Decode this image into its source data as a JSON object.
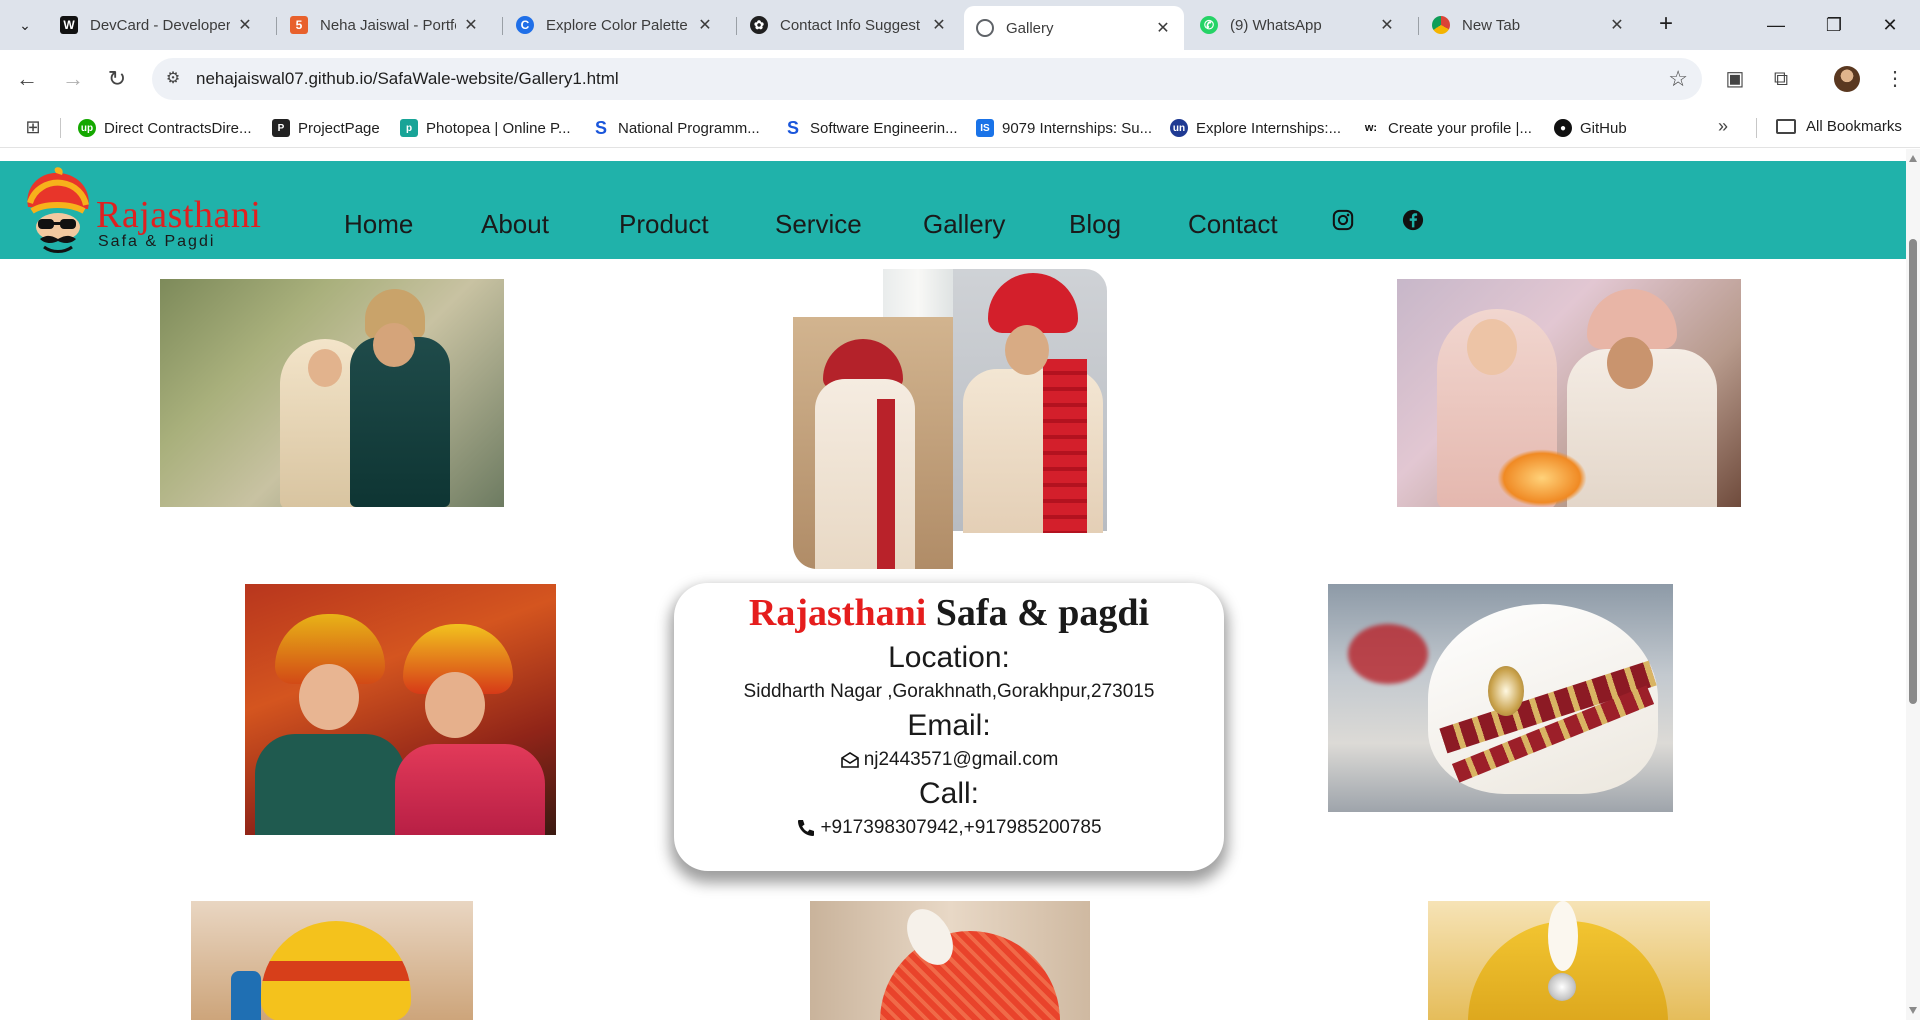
{
  "browser": {
    "tabs": [
      {
        "title": "DevCard - Developer",
        "icon": "w-icon",
        "color": "#111111"
      },
      {
        "title": "Neha Jaiswal - Portfo",
        "icon": "html5-icon",
        "color": "#e8612c"
      },
      {
        "title": "Explore Color Palette",
        "icon": "coolors-icon",
        "color": "#1f6fe8"
      },
      {
        "title": "Contact Info Suggest",
        "icon": "chatgpt-icon",
        "color": "#202020"
      },
      {
        "title": "Gallery",
        "icon": "globe-icon",
        "color": "#5f6368",
        "active": true
      },
      {
        "title": "(9) WhatsApp",
        "icon": "whatsapp-icon",
        "color": "#25d366"
      },
      {
        "title": "New Tab",
        "icon": "chrome-icon",
        "color": "#5f6368"
      }
    ],
    "url": "nehajaiswal07.github.io/SafaWale-website/Gallery1.html",
    "bookmarks": [
      {
        "label": "Direct ContractsDire...",
        "color": "#14a800",
        "letter": "up"
      },
      {
        "label": "ProjectPage",
        "color": "#222222",
        "letter": "P"
      },
      {
        "label": "Photopea | Online P...",
        "color": "#18a497",
        "letter": "p"
      },
      {
        "label": "National Programm...",
        "color": "#1a56db",
        "letter": "S"
      },
      {
        "label": "Software Engineerin...",
        "color": "#1a56db",
        "letter": "S"
      },
      {
        "label": "9079 Internships: Su...",
        "color": "#1a73e8",
        "letter": "IS"
      },
      {
        "label": "Explore Internships:...",
        "color": "#1f3a93",
        "letter": "un"
      },
      {
        "label": "Create your profile |...",
        "color": "#111111",
        "letter": "w:"
      },
      {
        "label": "GitHub",
        "color": "#111111",
        "letter": "gh"
      }
    ],
    "all_bookmarks_label": "All Bookmarks"
  },
  "site": {
    "logo_text": "Rajasthani",
    "logo_sub": "Safa & Pagdi",
    "nav": [
      "Home",
      "About",
      "Product",
      "Service",
      "Gallery",
      "Blog",
      "Contact"
    ],
    "social": [
      "instagram-icon",
      "facebook-icon"
    ],
    "brand_colors": {
      "nav_bg": "#20b2aa",
      "accent_red": "#e51d1d"
    }
  },
  "contact": {
    "title_red": "Rajasthani",
    "title_rest": " Safa & pagdi",
    "location_heading": "Location:",
    "location": "Siddharth Nagar ,Gorakhnath,Gorakhpur,273015",
    "email_heading": "Email:",
    "email": "nj2443571@gmail.com",
    "call_heading": "Call:",
    "phone": "+917398307942,+917985200785"
  },
  "gallery": [
    {
      "alt": "Sikh bride and groom",
      "caption": ""
    },
    {
      "alt": "Two grooms in red safa and sherwani",
      "caption": ""
    },
    {
      "alt": "Couple at wedding ceremony fire",
      "caption": ""
    },
    {
      "alt": "Two women in rajasthani turbans",
      "caption": ""
    },
    {
      "alt": "White and maroon groom safa with brooch",
      "caption": ""
    },
    {
      "alt": "Man in yellow turban",
      "caption": ""
    },
    {
      "alt": "Red turban with feather",
      "caption": ""
    },
    {
      "alt": "Yellow turban with feather brooch",
      "caption": ""
    }
  ]
}
